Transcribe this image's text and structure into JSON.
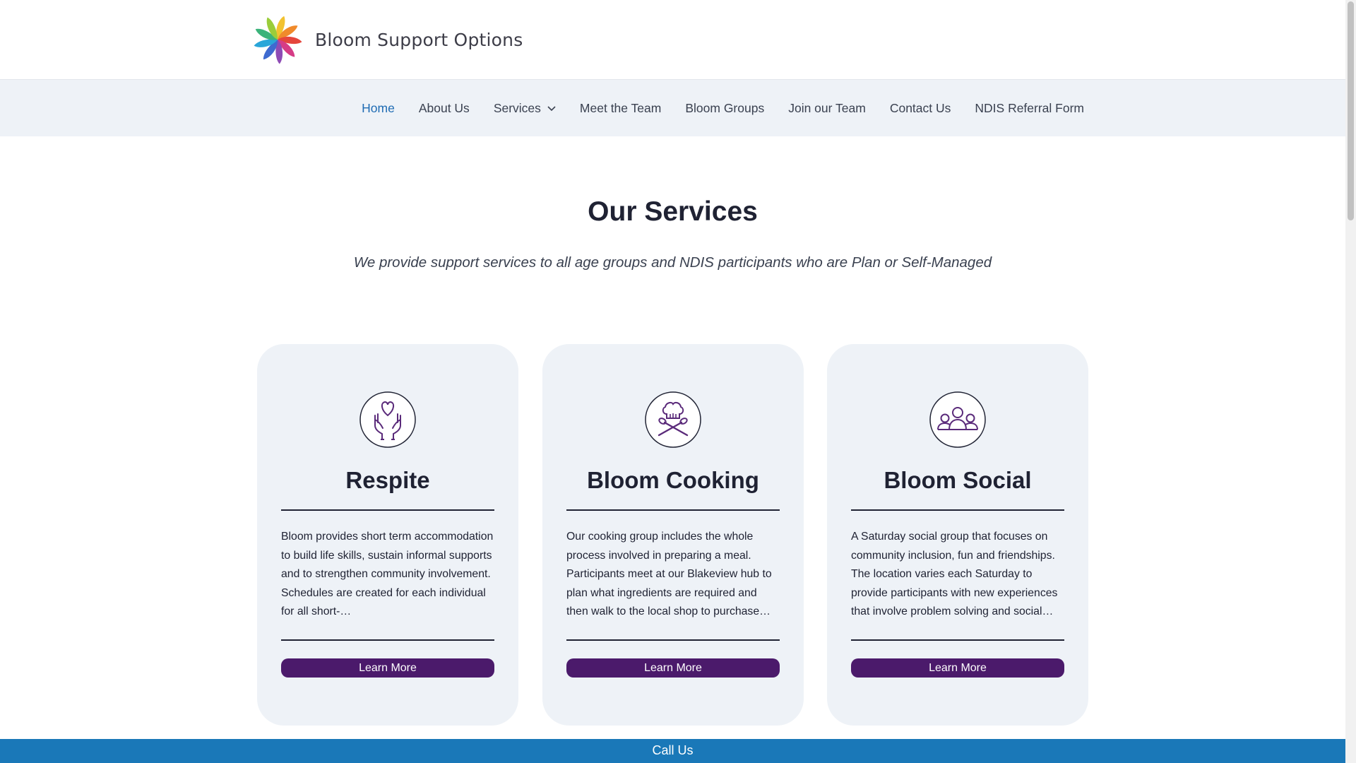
{
  "brand": {
    "name": "Bloom Support Options"
  },
  "nav": {
    "items": [
      {
        "label": "Home"
      },
      {
        "label": "About Us"
      },
      {
        "label": "Services"
      },
      {
        "label": "Meet the Team"
      },
      {
        "label": "Bloom Groups"
      },
      {
        "label": "Join our Team"
      },
      {
        "label": "Contact Us"
      },
      {
        "label": "NDIS Referral Form"
      }
    ]
  },
  "main": {
    "title": "Our Services",
    "subtitle": "We provide support services to all age groups and NDIS participants who are Plan or Self-Managed"
  },
  "cards": [
    {
      "icon": "heart-hands-icon",
      "title": "Respite",
      "text": "Bloom provides short term accommodation to build life skills, sustain informal supports and to strengthen community involvement. Schedules are created for each individual for all short-…",
      "button": "Learn More"
    },
    {
      "icon": "chef-cooking-icon",
      "title": "Bloom Cooking",
      "text": "Our cooking group includes the whole process involved in preparing a meal. Participants meet at our Blakeview hub to plan what ingredients are required and then walk to the local shop to purchase…",
      "button": "Learn More"
    },
    {
      "icon": "group-people-icon",
      "title": "Bloom Social",
      "text": "A Saturday social group that focuses on community inclusion, fun and friendships. The location varies each Saturday to provide participants with new experiences that involve problem solving and social…",
      "button": "Learn More"
    }
  ],
  "call_bar": {
    "label": "Call Us"
  },
  "colors": {
    "nav_active": "#1e6bb3",
    "card_background": "#eef2f7",
    "button_purple": "#4b1a6b",
    "call_bar_blue": "#1a78b8",
    "icon_purple": "#5a2a7a"
  }
}
